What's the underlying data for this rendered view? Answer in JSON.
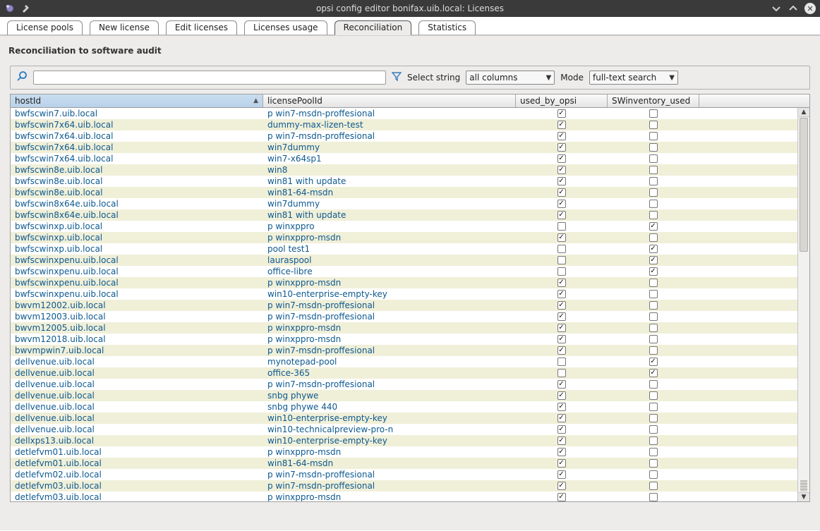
{
  "window": {
    "title": "opsi config editor bonifax.uib.local: Licenses"
  },
  "tabs": [
    {
      "label": "License pools"
    },
    {
      "label": "New license"
    },
    {
      "label": "Edit licenses"
    },
    {
      "label": "Licenses usage"
    },
    {
      "label": "Reconciliation",
      "active": true
    },
    {
      "label": "Statistics"
    }
  ],
  "panel": {
    "title": "Reconciliation to software audit",
    "search": {
      "placeholder": "",
      "select_string_label": "Select string",
      "select_string_value": "all columns",
      "mode_label": "Mode",
      "mode_value": "full-text search"
    },
    "columns": {
      "hostId": "hostId",
      "licensePoolId": "licensePoolId",
      "used_by_opsi": "used_by_opsi",
      "swinventory_used": "SWinventory_used"
    }
  },
  "rows": [
    {
      "host": "bwfscwin7.uib.local",
      "pool": "p_win7-msdn-proffesional",
      "used": true,
      "sw": false
    },
    {
      "host": "bwfscwin7x64.uib.local",
      "pool": "dummy-max-lizen-test",
      "used": true,
      "sw": false
    },
    {
      "host": "bwfscwin7x64.uib.local",
      "pool": "p_win7-msdn-proffesional",
      "used": true,
      "sw": false
    },
    {
      "host": "bwfscwin7x64.uib.local",
      "pool": "win7dummy",
      "used": true,
      "sw": false
    },
    {
      "host": "bwfscwin7x64.uib.local",
      "pool": "win7-x64sp1",
      "used": true,
      "sw": false
    },
    {
      "host": "bwfscwin8e.uib.local",
      "pool": "win8",
      "used": true,
      "sw": false
    },
    {
      "host": "bwfscwin8e.uib.local",
      "pool": "win81_with_update",
      "used": true,
      "sw": false
    },
    {
      "host": "bwfscwin8e.uib.local",
      "pool": "win81-64-msdn",
      "used": true,
      "sw": false
    },
    {
      "host": "bwfscwin8x64e.uib.local",
      "pool": "win7dummy",
      "used": true,
      "sw": false
    },
    {
      "host": "bwfscwin8x64e.uib.local",
      "pool": "win81_with_update",
      "used": true,
      "sw": false
    },
    {
      "host": "bwfscwinxp.uib.local",
      "pool": "p_winxppro",
      "used": false,
      "sw": true
    },
    {
      "host": "bwfscwinxp.uib.local",
      "pool": "p_winxppro-msdn",
      "used": true,
      "sw": false
    },
    {
      "host": "bwfscwinxp.uib.local",
      "pool": "pool_test1",
      "used": false,
      "sw": true
    },
    {
      "host": "bwfscwinxpenu.uib.local",
      "pool": "lauraspool",
      "used": false,
      "sw": true
    },
    {
      "host": "bwfscwinxpenu.uib.local",
      "pool": "office-libre",
      "used": false,
      "sw": true
    },
    {
      "host": "bwfscwinxpenu.uib.local",
      "pool": "p_winxppro-msdn",
      "used": true,
      "sw": false
    },
    {
      "host": "bwfscwinxpenu.uib.local",
      "pool": "win10-enterprise-empty-key",
      "used": true,
      "sw": false
    },
    {
      "host": "bwvm12002.uib.local",
      "pool": "p_win7-msdn-proffesional",
      "used": true,
      "sw": false
    },
    {
      "host": "bwvm12003.uib.local",
      "pool": "p_win7-msdn-proffesional",
      "used": true,
      "sw": false
    },
    {
      "host": "bwvm12005.uib.local",
      "pool": "p_winxppro-msdn",
      "used": true,
      "sw": false
    },
    {
      "host": "bwvm12018.uib.local",
      "pool": "p_winxppro-msdn",
      "used": true,
      "sw": false
    },
    {
      "host": "bwvmpwin7.uib.local",
      "pool": "p_win7-msdn-proffesional",
      "used": true,
      "sw": false
    },
    {
      "host": "dellvenue.uib.local",
      "pool": "mynotepad-pool",
      "used": false,
      "sw": true
    },
    {
      "host": "dellvenue.uib.local",
      "pool": "office-365",
      "used": false,
      "sw": true
    },
    {
      "host": "dellvenue.uib.local",
      "pool": "p_win7-msdn-proffesional",
      "used": true,
      "sw": false
    },
    {
      "host": "dellvenue.uib.local",
      "pool": "snbg_phywe",
      "used": true,
      "sw": false
    },
    {
      "host": "dellvenue.uib.local",
      "pool": "snbg_phywe_440",
      "used": true,
      "sw": false
    },
    {
      "host": "dellvenue.uib.local",
      "pool": "win10-enterprise-empty-key",
      "used": true,
      "sw": false
    },
    {
      "host": "dellvenue.uib.local",
      "pool": "win10-technicalpreview-pro-n",
      "used": true,
      "sw": false
    },
    {
      "host": "dellxps13.uib.local",
      "pool": "win10-enterprise-empty-key",
      "used": true,
      "sw": false
    },
    {
      "host": "detlefvm01.uib.local",
      "pool": "p_winxppro-msdn",
      "used": true,
      "sw": false
    },
    {
      "host": "detlefvm01.uib.local",
      "pool": "win81-64-msdn",
      "used": true,
      "sw": false
    },
    {
      "host": "detlefvm02.uib.local",
      "pool": "p_win7-msdn-proffesional",
      "used": true,
      "sw": false
    },
    {
      "host": "detlefvm03.uib.local",
      "pool": "p_win7-msdn-proffesional",
      "used": true,
      "sw": false
    },
    {
      "host": "detlefvm03.uib.local",
      "pool": "p_winxppro-msdn",
      "used": true,
      "sw": false
    }
  ]
}
